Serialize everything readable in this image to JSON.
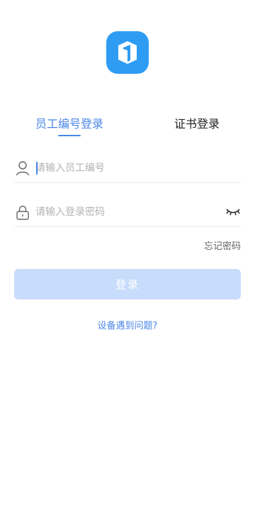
{
  "brand": {
    "logo_icon": "app-cube-logo-icon",
    "color": "#2f9cf4"
  },
  "tabs": [
    {
      "label": "员工编号登录",
      "active": true
    },
    {
      "label": "证书登录",
      "active": false
    }
  ],
  "form": {
    "employee_id": {
      "placeholder": "请输入员工编号",
      "value": "",
      "icon": "user-icon"
    },
    "password": {
      "placeholder": "请输入登录密码",
      "value": "",
      "icon": "lock-icon",
      "toggle_icon": "eye-closed-icon"
    }
  },
  "links": {
    "forgot_password": "忘记密码",
    "help": "设备遇到问题?"
  },
  "login_button": {
    "label": "登录",
    "enabled": false
  },
  "colors": {
    "accent": "#4a86e8",
    "button_disabled": "#c8dcfb"
  }
}
